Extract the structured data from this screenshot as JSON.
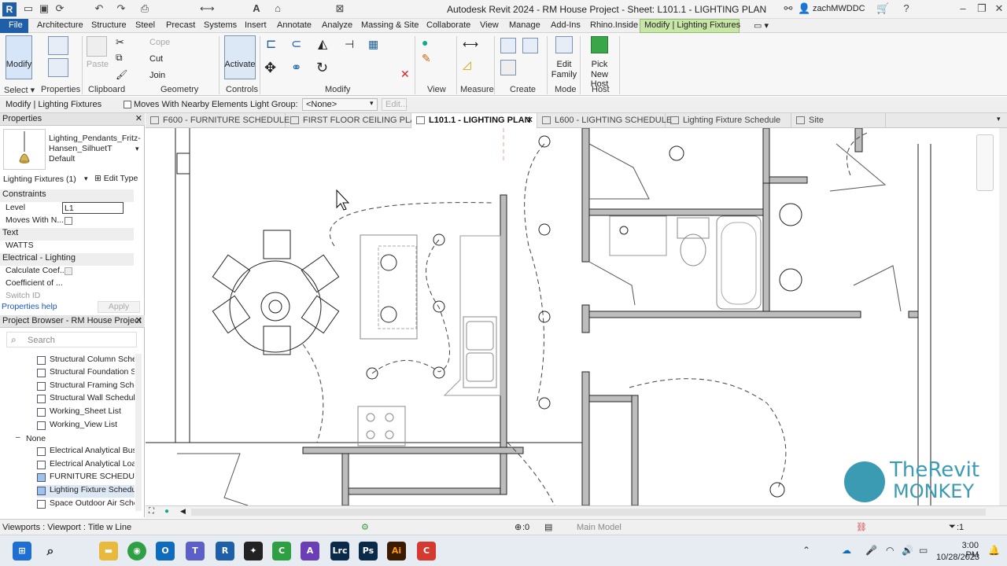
{
  "window": {
    "title": "Autodesk Revit 2024 - RM House Project - Sheet: L101.1 - LIGHTING PLAN",
    "user": "zachMWDDC"
  },
  "menu": [
    "File",
    "Architecture",
    "Structure",
    "Steel",
    "Precast",
    "Systems",
    "Insert",
    "Annotate",
    "Analyze",
    "Massing & Site",
    "Collaborate",
    "View",
    "Manage",
    "Add-Ins",
    "Rhino.Inside",
    "Modify | Lighting Fixtures"
  ],
  "ribbon": {
    "modify_label": "Modify",
    "paste_label": "Paste",
    "cope_label": "Cope",
    "cut_label": "Cut",
    "join_label": "Join",
    "activate_label": "Activate",
    "edit_family_label1": "Edit",
    "edit_family_label2": "Family",
    "pick_host_label1": "Pick",
    "pick_host_label2": "New Host",
    "panels": [
      "Select ▾",
      "Properties",
      "Clipboard",
      "Geometry",
      "Controls",
      "Modify",
      "View",
      "Measure",
      "Create",
      "Mode",
      "Host"
    ]
  },
  "optionsbar": {
    "context": "Modify | Lighting Fixtures",
    "moves_label": "Moves With Nearby Elements",
    "light_group_label": "Light Group:",
    "light_group_value": "<None>",
    "edit_label": "Edit..."
  },
  "properties": {
    "title": "Properties",
    "type_line1": "Lighting_Pendants_Fritz-",
    "type_line2": "Hansen_SilhuetT",
    "type_line3": "Default",
    "selector": "Lighting Fixtures (1)",
    "edit_type": "Edit Type",
    "cat_constraints": "Constraints",
    "level_label": "Level",
    "level_value": "L1",
    "moves_label": "Moves With N...",
    "cat_text": "Text",
    "watts": "WATTS",
    "cat_electrical": "Electrical - Lighting",
    "calc_coef": "Calculate Coef...",
    "coef_of": "Coefficient of ...",
    "switch_id": "Switch ID",
    "help": "Properties help",
    "apply": "Apply"
  },
  "browser": {
    "title": "Project Browser - RM House Project",
    "search_placeholder": "Search",
    "items_a": [
      "Structural Column Sche",
      "Structural Foundation S",
      "Structural Framing Sche",
      "Structural Wall Schedule",
      "Working_Sheet List",
      "Working_View List"
    ],
    "group": "None",
    "items_b": [
      "Electrical Analytical Bus",
      "Electrical Analytical Load",
      "FURNITURE SCHEDULE",
      "Lighting Fixture Schedu",
      "Space Outdoor Air Sche"
    ]
  },
  "tabs": [
    "F600 - FURNITURE SCHEDULE",
    "FIRST FLOOR CEILING PLAN",
    "L101.1 - LIGHTING PLAN",
    "L600 - LIGHTING SCHEDULE",
    "Lighting Fixture Schedule",
    "Site"
  ],
  "status": {
    "left": "Viewports : Viewport : Title w Line",
    "zero": ":0",
    "model": "Main Model",
    "filter": ":1"
  },
  "watermark": {
    "line1": "TheRevit",
    "line2": "MONKEY"
  },
  "taskbar": {
    "time": "3:00 PM",
    "date": "10/28/2023"
  },
  "colors": {
    "ribbon_context": "#c9e6a8",
    "file_tab": "#1f5fa8",
    "accent": "#3a9bb3"
  }
}
